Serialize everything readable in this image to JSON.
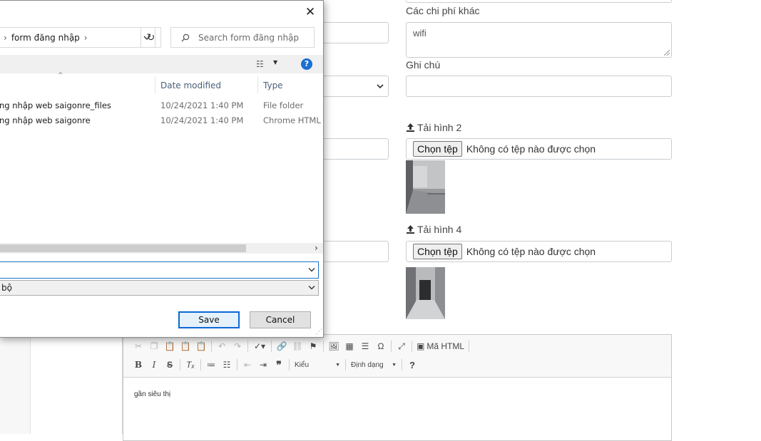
{
  "form": {
    "other_costs_label": "Các chi phí khác",
    "other_costs_value": "wifi",
    "notes_label": "Ghi chú",
    "upload2_label": "Tải hình 2",
    "upload4_label": "Tải hình 4",
    "choose_file_label": "Chọn tệp",
    "no_file_text": "Không có tệp nào được chọn"
  },
  "editor": {
    "source_label": "Mã HTML",
    "styles_label": "Kiểu",
    "format_label": "Định dạng",
    "body_text": "gần siêu thị"
  },
  "dialog": {
    "breadcrumb": "form đăng nhập",
    "search_placeholder": "Search form đăng nhập",
    "columns": {
      "date": "Date modified",
      "type": "Type"
    },
    "files": [
      {
        "name": "ng nhập web saigonre_files",
        "date": "10/24/2021 1:40 PM",
        "type": "File folder"
      },
      {
        "name": "ng nhập web saigonre",
        "date": "10/24/2021 1:40 PM",
        "type": "Chrome HTML D"
      }
    ],
    "filename_value": "",
    "filetype_value": "bộ",
    "save_label": "Save",
    "cancel_label": "Cancel"
  },
  "colors": {
    "accent": "#0b69d4",
    "help": "#1a6fd1"
  }
}
